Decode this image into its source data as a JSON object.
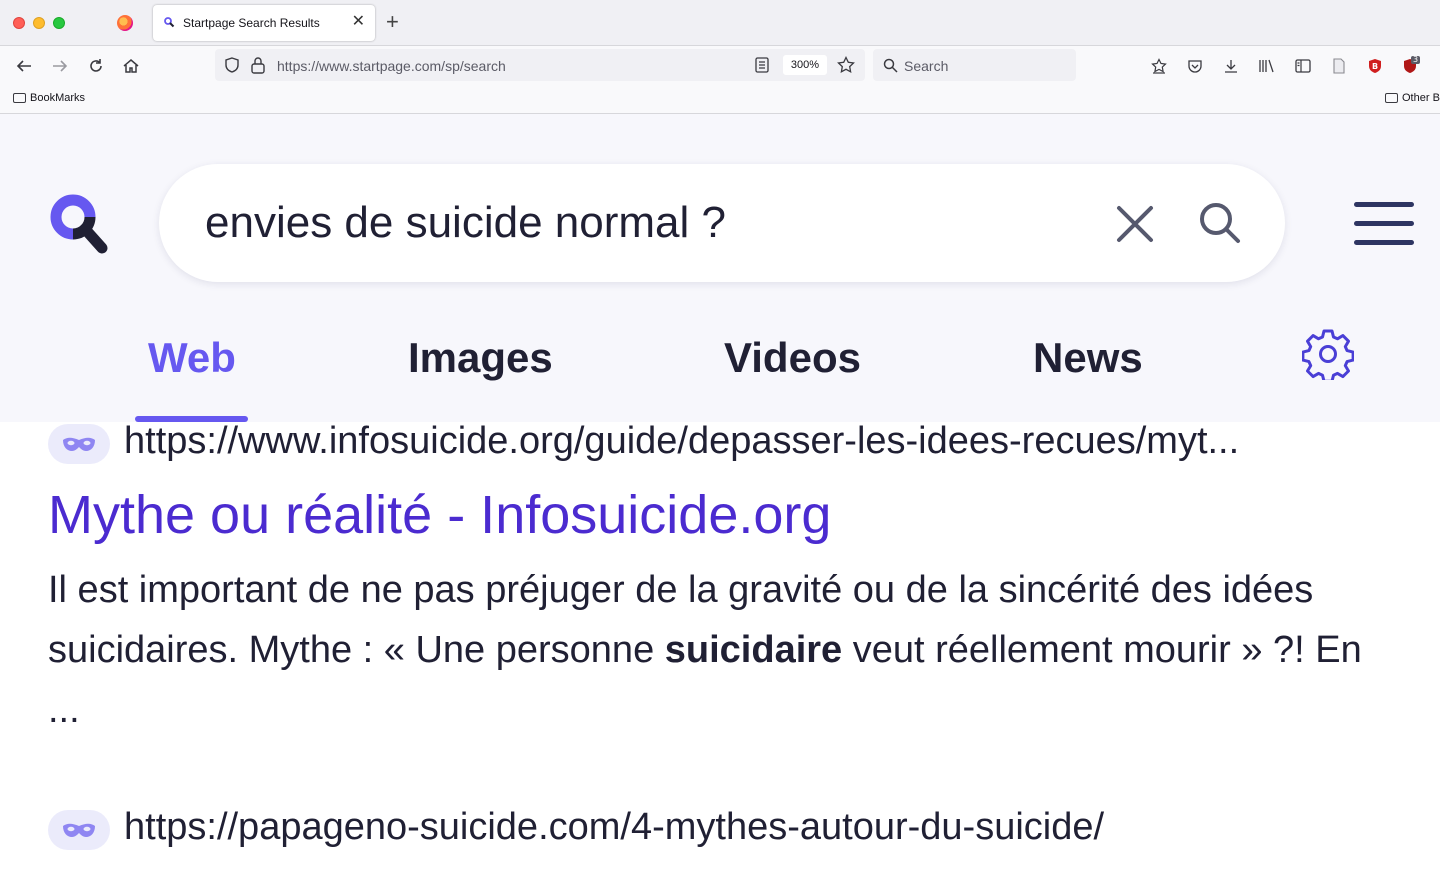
{
  "browser": {
    "tab_title": "Startpage Search Results",
    "url": "https://www.startpage.com/sp/search",
    "zoom": "300%",
    "search_placeholder": "Search",
    "bookmarks": [
      "BookMarks",
      "Other B"
    ],
    "extension_badge": "3"
  },
  "search": {
    "query": "envies de suicide normal ?"
  },
  "tabs": [
    {
      "label": "Web",
      "active": true
    },
    {
      "label": "Images",
      "active": false
    },
    {
      "label": "Videos",
      "active": false
    },
    {
      "label": "News",
      "active": false
    }
  ],
  "results": [
    {
      "url": "https://www.infosuicide.org/guide/depasser-les-idees-recues/myt...",
      "title": "Mythe ou réalité - Infosuicide.org",
      "snippet_before": "Il est important de ne pas préjuger de la gravité ou de la sincérité des idées suicidaires. Mythe : « Une personne ",
      "snippet_bold": "suicidaire",
      "snippet_after": " veut réellement mourir » ?! En ..."
    },
    {
      "url": "https://papageno-suicide.com/4-mythes-autour-du-suicide/"
    }
  ],
  "colors": {
    "accent": "#6658f0",
    "title_link": "#4b2bd0",
    "header_bg": "#f7f7fc",
    "text": "#202034"
  }
}
